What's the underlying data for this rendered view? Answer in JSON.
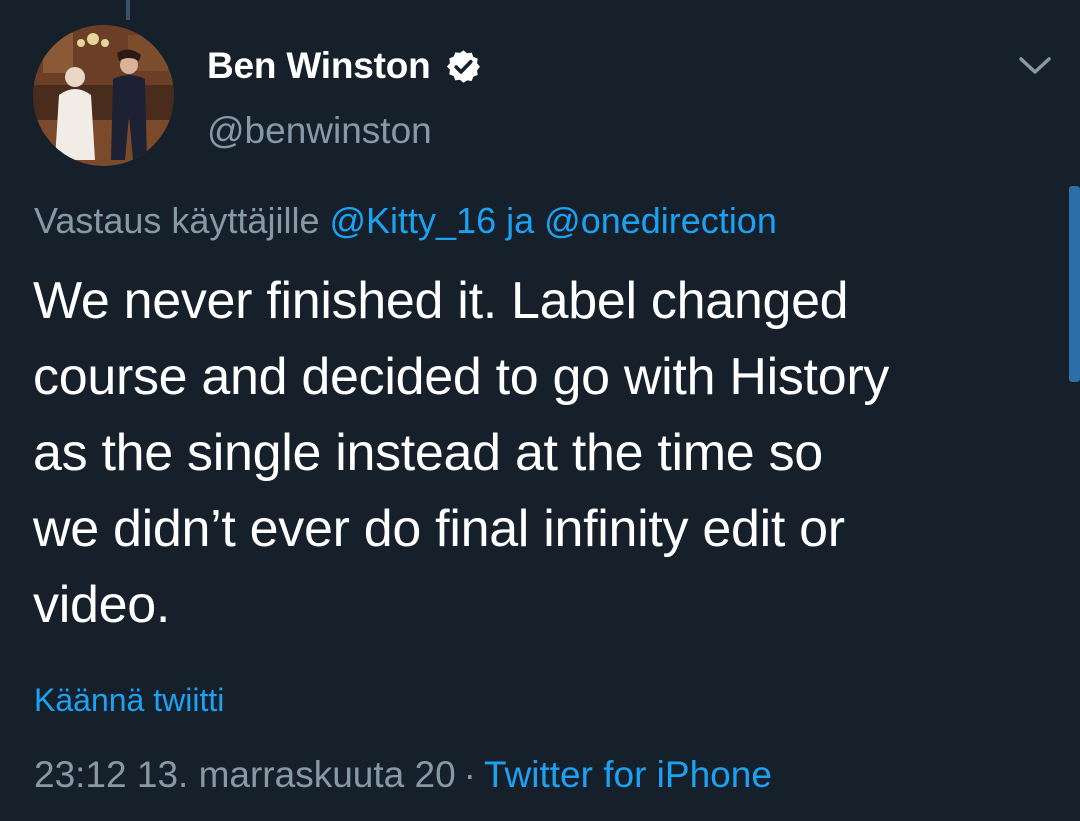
{
  "author": {
    "display_name": "Ben Winston",
    "handle": "@benwinston",
    "verified": true
  },
  "icons": {
    "verified": "verified-badge-icon",
    "more": "chevron-down-icon"
  },
  "reply": {
    "prefix": "Vastaus käyttäjille",
    "mention_1": "@Kitty_16",
    "connector": "ja",
    "mention_2": "@onedirection"
  },
  "tweet": {
    "lines": [
      "We never finished it. Label changed",
      "course and decided to go with History",
      "as the single instead at the time so",
      "we didn’t ever do final infinity edit or",
      "video."
    ]
  },
  "translate_label": "Käännä twiitti",
  "meta": {
    "timestamp": "23:12 13. marraskuuta 20",
    "separator": "·",
    "client": "Twitter for iPhone"
  },
  "colors": {
    "background": "#15202b",
    "primary_text": "#ffffff",
    "secondary_text": "#8899a6",
    "accent": "#1da1f2"
  }
}
